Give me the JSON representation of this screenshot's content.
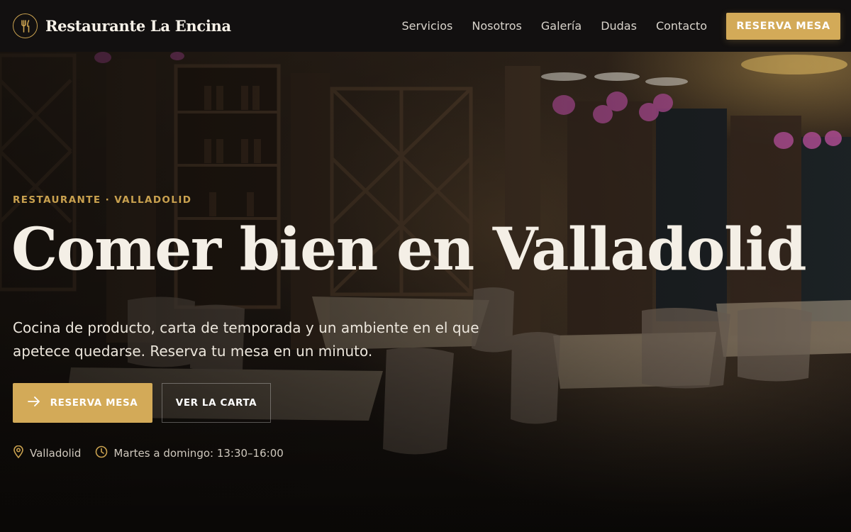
{
  "header": {
    "brand": "Restaurante La Encina",
    "nav": [
      {
        "label": "Servicios"
      },
      {
        "label": "Nosotros"
      },
      {
        "label": "Galería"
      },
      {
        "label": "Dudas"
      },
      {
        "label": "Contacto"
      }
    ],
    "cta_label": "RESERVA MESA"
  },
  "hero": {
    "eyebrow": "RESTAURANTE · VALLADOLID",
    "headline": "Comer bien en Valladolid",
    "subtitle": "Cocina de producto, carta de temporada y un ambiente en el que apetece quedarse. Reserva tu mesa en un minuto.",
    "primary_cta": "RESERVA MESA",
    "secondary_cta": "VER LA CARTA",
    "location": "Valladolid",
    "hours": "Martes a domingo: 13:30–16:00"
  },
  "icons": {
    "logo": "fork-knife-icon",
    "primary_cta": "arrow-right-icon",
    "location": "map-pin-icon",
    "hours": "clock-icon"
  },
  "colors": {
    "accent": "#d3aa58",
    "header_bg": "#121010",
    "headline": "#f4efe6"
  }
}
